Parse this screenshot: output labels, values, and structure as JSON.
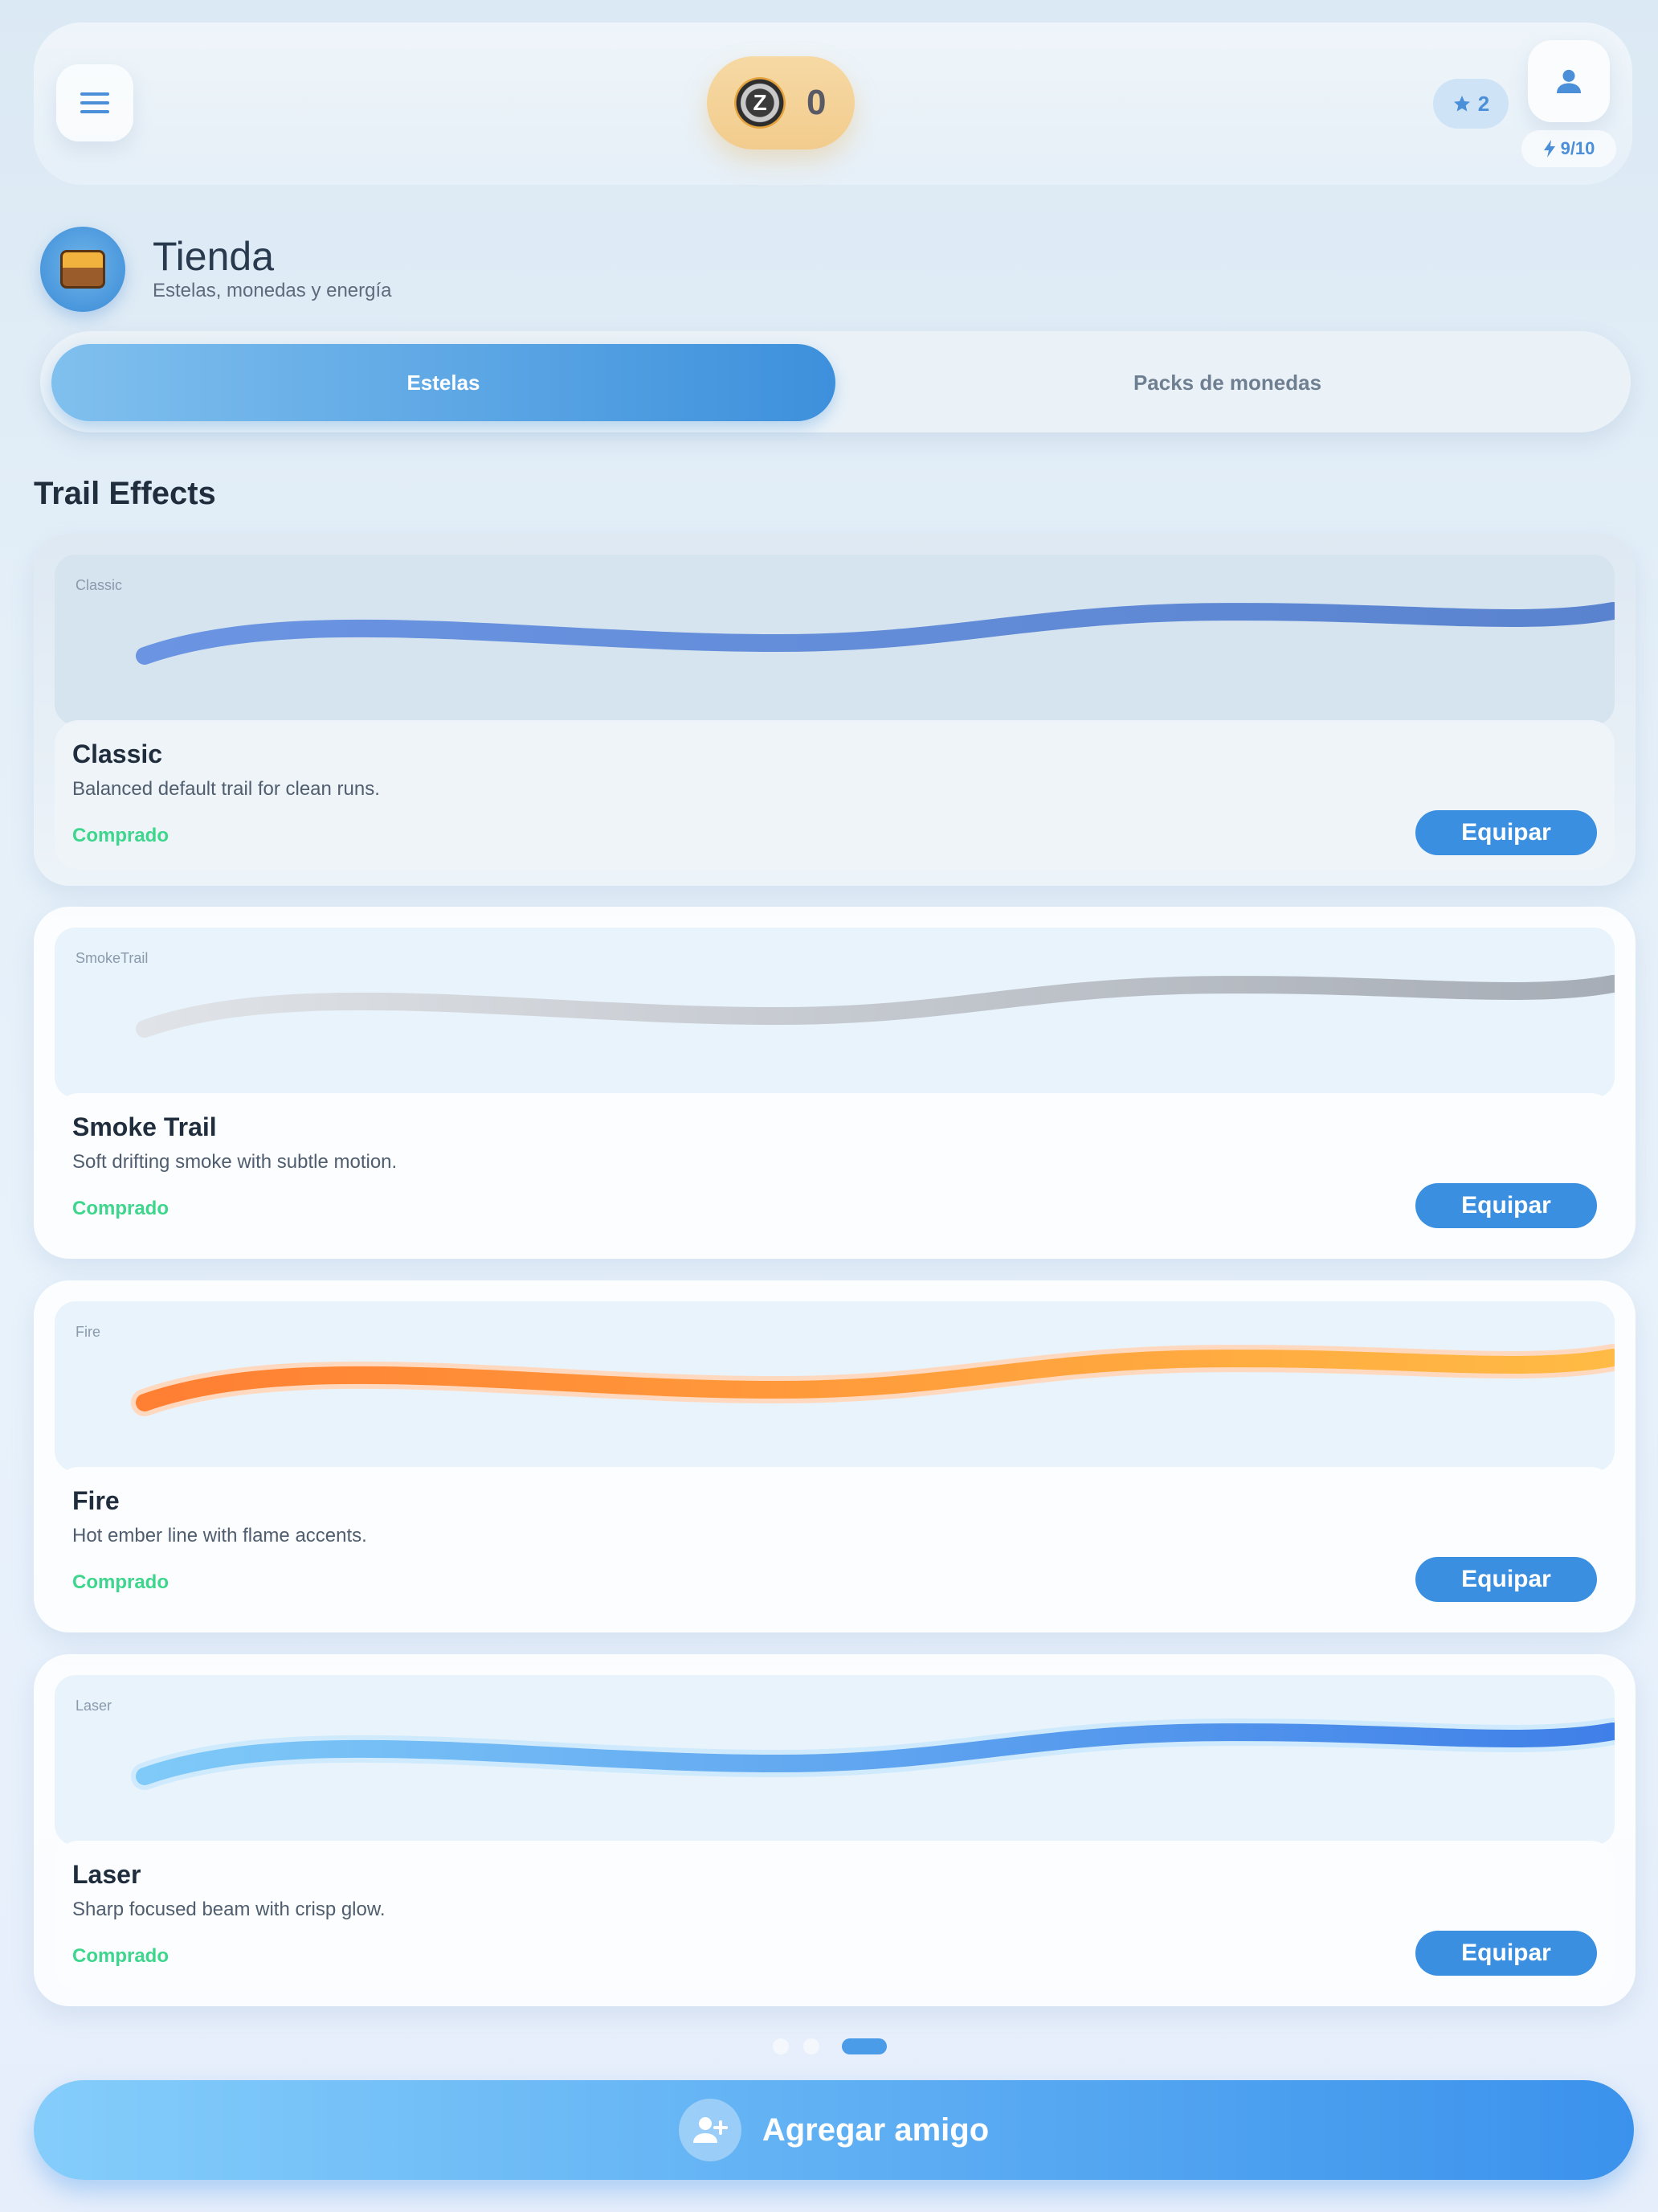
{
  "header": {
    "coins": "0",
    "stars": "2",
    "energy": "9/10"
  },
  "page": {
    "title": "Tienda",
    "subtitle": "Estelas, monedas y energía"
  },
  "tabs": [
    {
      "label": "Estelas",
      "active": true
    },
    {
      "label": "Packs de monedas",
      "active": false
    }
  ],
  "section_title": "Trail Effects",
  "items": [
    {
      "preview_label": "Classic",
      "name": "Classic",
      "description": "Balanced default trail for clean runs.",
      "status": "Comprado",
      "action": "Equipar",
      "colors": [
        "#6b95e2",
        "#5a83cf"
      ]
    },
    {
      "preview_label": "SmokeTrail",
      "name": "Smoke Trail",
      "description": "Soft drifting smoke with subtle motion.",
      "status": "Comprado",
      "action": "Equipar",
      "colors": [
        "#e0e3e7",
        "#a7adb6"
      ]
    },
    {
      "preview_label": "Fire",
      "name": "Fire",
      "description": "Hot ember line with flame accents.",
      "status": "Comprado",
      "action": "Equipar",
      "colors": [
        "#ff7f33",
        "#ffbb45"
      ]
    },
    {
      "preview_label": "Laser",
      "name": "Laser",
      "description": "Sharp focused beam with crisp glow.",
      "status": "Comprado",
      "action": "Equipar",
      "colors": [
        "#7fcaf8",
        "#3f7fe8"
      ]
    }
  ],
  "pager": {
    "pages": 3,
    "active": 3
  },
  "footer": {
    "add_friend_label": "Agregar amigo"
  },
  "colors": {
    "accent": "#3a8fe0",
    "success": "#3dd68c"
  }
}
